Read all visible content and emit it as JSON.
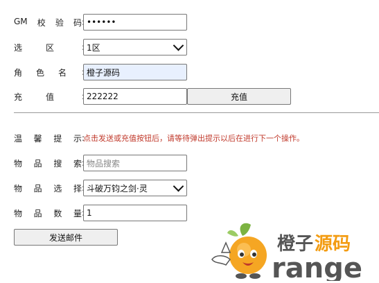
{
  "form": {
    "gm_code": {
      "label": [
        "GM",
        "校",
        "验",
        "码"
      ],
      "value": "••••••"
    },
    "zone": {
      "label": [
        "选",
        "区"
      ],
      "value": "1区"
    },
    "role": {
      "label": [
        "角",
        "色",
        "名"
      ],
      "value": "橙子源码"
    },
    "recharge": {
      "label": [
        "充",
        "值"
      ],
      "value": "222222",
      "button": "充值"
    },
    "tip": {
      "label": [
        "温",
        "馨",
        "提",
        "示"
      ],
      "text": "点击发送或充值按钮后，请等待弹出提示以后在进行下一个操作。"
    },
    "item_search": {
      "label": [
        "物",
        "品",
        "搜",
        "索"
      ],
      "placeholder": "物品搜索"
    },
    "item_select": {
      "label": [
        "物",
        "品",
        "选",
        "择"
      ],
      "value": "斗破万钧之剑·灵"
    },
    "item_qty": {
      "label": [
        "物",
        "品",
        "数",
        "量"
      ],
      "value": "1"
    },
    "send_button": "发送邮件"
  },
  "watermark": {
    "brand_cn_1": "橙子",
    "brand_cn_2": "源码",
    "brand_en": "range"
  },
  "colors": {
    "tip": "#c0392b",
    "brand_orange": "#f39c12",
    "brand_gray": "#555555"
  },
  "icons": {
    "select_arrow": "chevron-down-icon",
    "logo": "orange-mascot-icon"
  }
}
